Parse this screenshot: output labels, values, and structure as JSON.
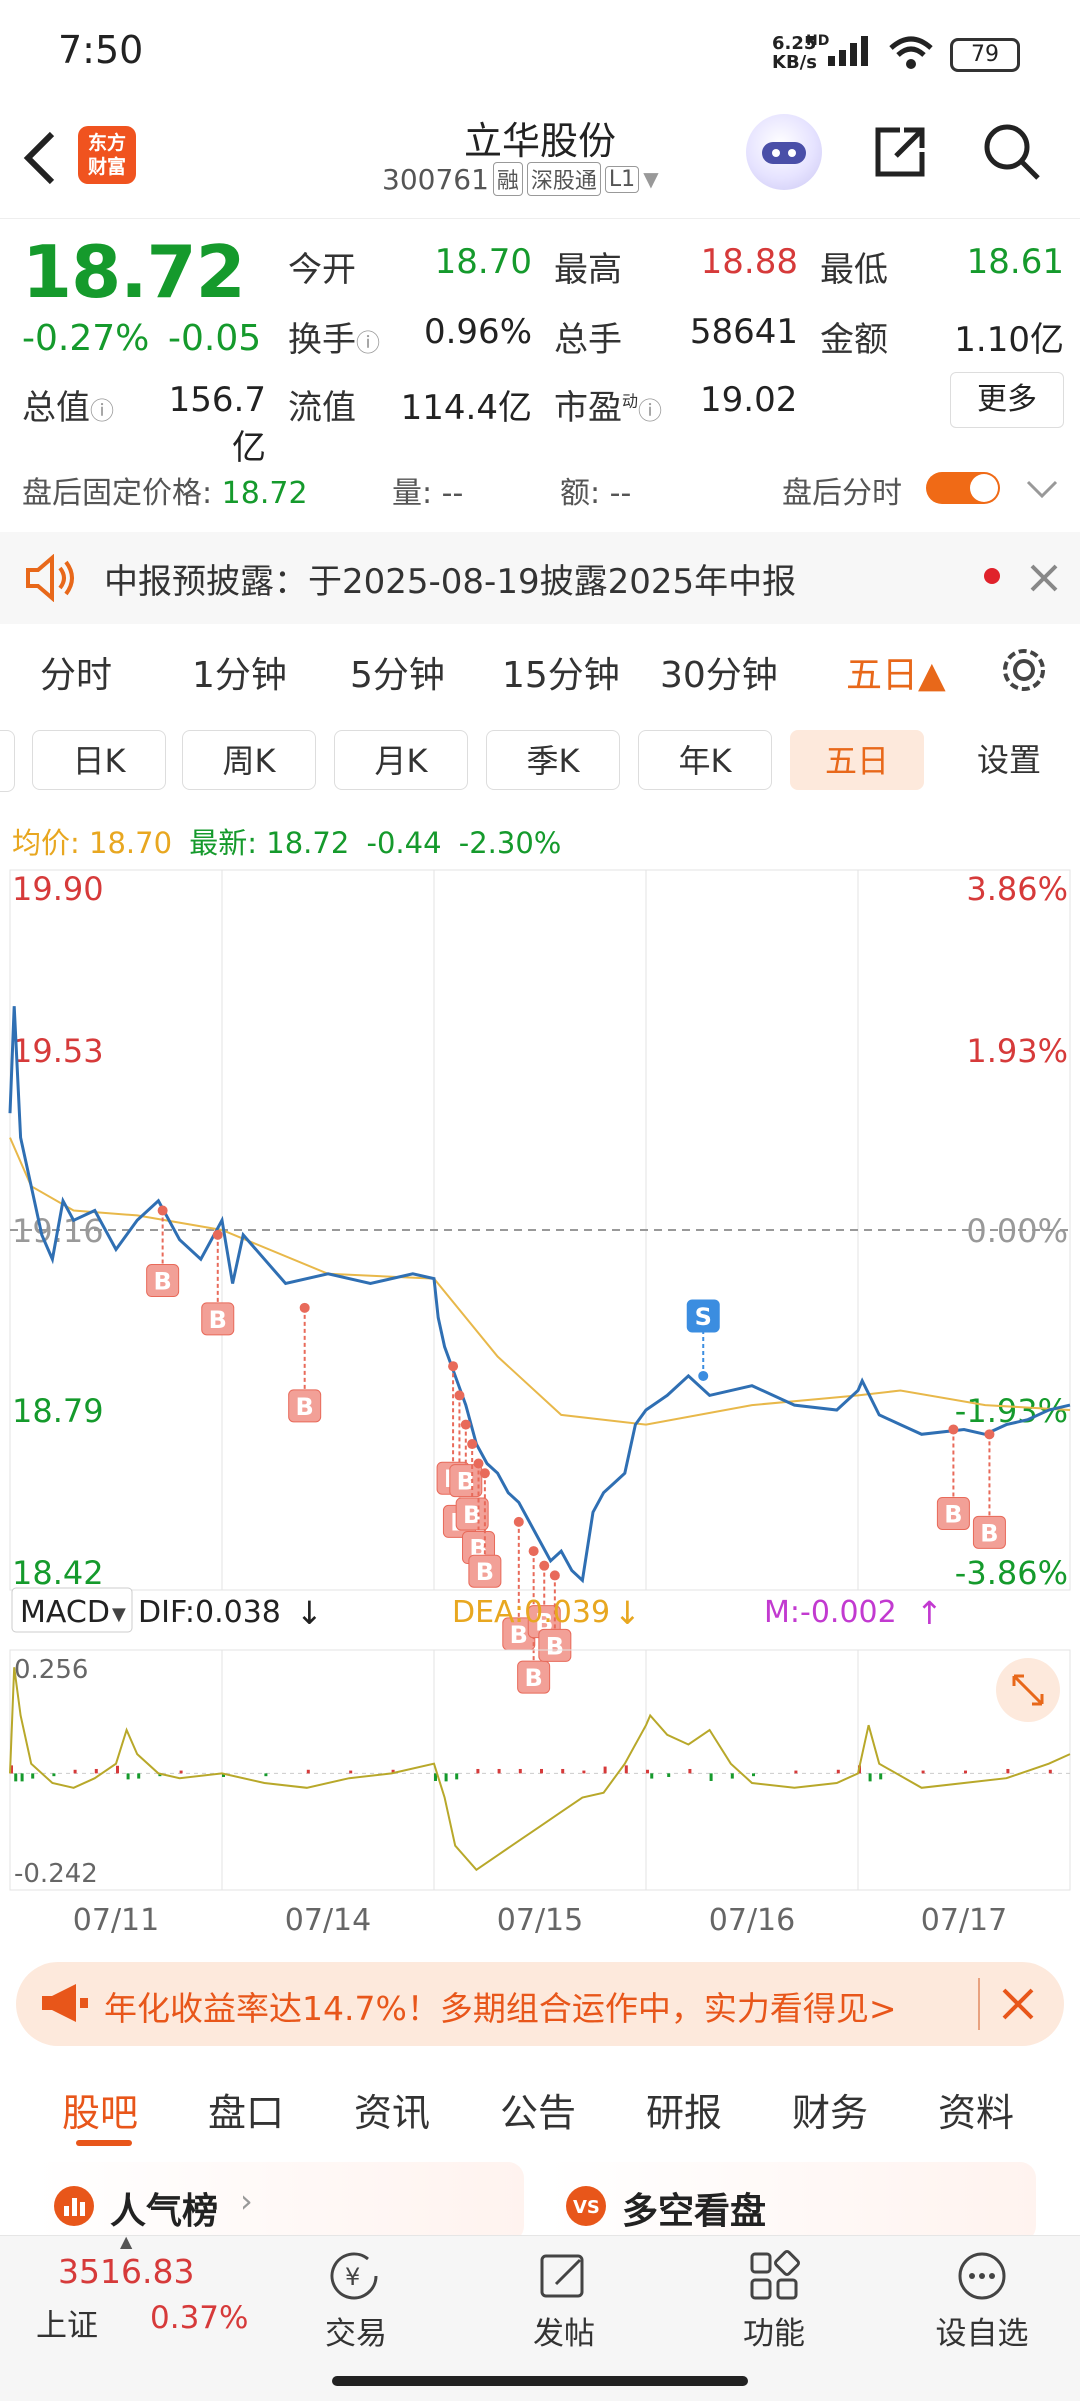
{
  "status_bar": {
    "time": "7:50",
    "net_speed_value": "6.25",
    "net_speed_unit": "KB/s",
    "network": "HD",
    "battery": "79"
  },
  "header": {
    "logo_line1": "东方",
    "logo_line2": "财富",
    "stock_name": "立华股份",
    "stock_code": "300761",
    "tags": [
      "融",
      "深股通",
      "L1"
    ]
  },
  "quote": {
    "price": "18.72",
    "change_pct": "-0.27%",
    "change_abs": "-0.05",
    "open_label": "今开",
    "open": "18.70",
    "high_label": "最高",
    "high": "18.88",
    "low_label": "最低",
    "low": "18.61",
    "turnover_label": "换手",
    "turnover": "0.96%",
    "volume_label": "总手",
    "volume": "58641",
    "amount_label": "金额",
    "amount": "1.10亿",
    "mktcap_label": "总值",
    "mktcap": "156.7亿",
    "float_label": "流值",
    "float": "114.4亿",
    "pe_label": "市盈",
    "pe_sup": "动",
    "pe": "19.02",
    "more_button": "更多"
  },
  "after_hours": {
    "fixed_price_label": "盘后固定价格:",
    "fixed_price": "18.72",
    "vol_label": "量:",
    "vol": "--",
    "amt_label": "额:",
    "amt": "--",
    "toggle_label": "盘后分时",
    "toggle_on": true
  },
  "notice": {
    "text": "中报预披露：于2025-08-19披露2025年中报"
  },
  "period_tabs": [
    "分时",
    "1分钟",
    "5分钟",
    "15分钟",
    "30分钟",
    "五日▲"
  ],
  "k_tabs": [
    "日K",
    "周K",
    "月K",
    "季K",
    "年K",
    "五日",
    "设置"
  ],
  "chart_legend": {
    "avg_label": "均价:",
    "avg": "18.70",
    "latest_label": "最新:",
    "latest": "18.72",
    "chg": "-0.44",
    "chg_pct": "-2.30%"
  },
  "chart_data": [
    {
      "type": "line",
      "y_left_ticks": [
        "19.90",
        "19.53",
        "19.16",
        "18.79",
        "18.42"
      ],
      "y_right_ticks": [
        "3.86%",
        "1.93%",
        "0.00%",
        "-1.93%",
        "-3.86%"
      ],
      "ylim": [
        18.42,
        19.9
      ],
      "x_tick_labels": [
        "07/11",
        "07/14",
        "07/15",
        "07/16",
        "07/17"
      ],
      "series": [
        {
          "x": [
            0,
            0.02,
            0.05,
            0.1,
            0.15,
            0.2,
            0.25,
            0.3,
            0.4,
            0.5,
            0.6,
            0.7,
            0.8,
            0.9,
            1.0,
            1.05,
            1.1,
            1.2,
            1.3,
            1.5,
            1.7,
            1.9,
            2.0,
            2.02,
            2.05,
            2.1,
            2.15,
            2.2,
            2.25,
            2.3,
            2.35,
            2.4,
            2.45,
            2.5,
            2.55,
            2.6,
            2.65,
            2.7,
            2.75,
            2.8,
            2.85,
            2.9,
            2.95,
            3.0,
            3.1,
            3.2,
            3.3,
            3.5,
            3.7,
            3.9,
            4.0,
            4.02,
            4.1,
            4.2,
            4.3,
            4.5,
            4.6,
            4.7,
            4.8,
            4.9,
            5.0
          ],
          "values": [
            19.4,
            19.62,
            19.35,
            19.25,
            19.15,
            19.1,
            19.22,
            19.18,
            19.2,
            19.12,
            19.18,
            19.22,
            19.14,
            19.1,
            19.18,
            19.05,
            19.15,
            19.1,
            19.05,
            19.07,
            19.05,
            19.07,
            19.06,
            18.98,
            18.92,
            18.86,
            18.8,
            18.72,
            18.68,
            18.66,
            18.62,
            18.6,
            18.56,
            18.52,
            18.48,
            18.5,
            18.46,
            18.44,
            18.58,
            18.62,
            18.64,
            18.66,
            18.76,
            18.79,
            18.82,
            18.86,
            18.82,
            18.84,
            18.8,
            18.79,
            18.83,
            18.85,
            18.78,
            18.76,
            18.74,
            18.75,
            18.74,
            18.76,
            18.77,
            18.79,
            18.8
          ]
        },
        {
          "x": [
            0,
            0.1,
            0.3,
            0.6,
            1.0,
            1.5,
            2.0,
            2.3,
            2.6,
            3.0,
            3.5,
            4.0,
            4.2,
            4.6,
            5.0
          ],
          "values": [
            19.35,
            19.25,
            19.2,
            19.19,
            19.16,
            19.07,
            19.06,
            18.9,
            18.78,
            18.76,
            18.8,
            18.82,
            18.83,
            18.8,
            18.79
          ]
        }
      ],
      "markers": [
        {
          "label": "S",
          "x": 3.27,
          "y": 18.86
        },
        {
          "label": "B",
          "x": 0.72,
          "y": 19.2
        },
        {
          "label": "B",
          "x": 0.98,
          "y": 19.15
        },
        {
          "label": "B",
          "x": 1.39,
          "y": 19.0
        },
        {
          "label": "B",
          "x": 2.09,
          "y": 18.88
        },
        {
          "label": "B",
          "x": 2.12,
          "y": 18.82
        },
        {
          "label": "B",
          "x": 2.15,
          "y": 18.76
        },
        {
          "label": "B",
          "x": 2.18,
          "y": 18.72
        },
        {
          "label": "B",
          "x": 2.21,
          "y": 18.68
        },
        {
          "label": "B",
          "x": 2.24,
          "y": 18.66
        },
        {
          "label": "B",
          "x": 2.4,
          "y": 18.56
        },
        {
          "label": "B",
          "x": 2.47,
          "y": 18.5
        },
        {
          "label": "B",
          "x": 2.52,
          "y": 18.47
        },
        {
          "label": "B",
          "x": 2.57,
          "y": 18.45
        },
        {
          "label": "B",
          "x": 4.45,
          "y": 18.75
        },
        {
          "label": "B",
          "x": 4.62,
          "y": 18.74
        }
      ]
    },
    {
      "type": "line",
      "indicator_label": "MACD",
      "dif_label": "DIF:0.038",
      "dea_label": "DEA:0.039",
      "m_label": "M:-0.002",
      "ylim": [
        -0.242,
        0.256
      ],
      "y_ticks": [
        "0.256",
        "-0.242"
      ],
      "series": [
        {
          "x": [
            0,
            0.02,
            0.05,
            0.1,
            0.2,
            0.3,
            0.4,
            0.5,
            0.55,
            0.6,
            0.7,
            0.8,
            1.0,
            1.2,
            1.4,
            1.6,
            1.8,
            2.0,
            2.05,
            2.1,
            2.2,
            2.3,
            2.4,
            2.5,
            2.6,
            2.7,
            2.8,
            2.9,
            3.0,
            3.02,
            3.1,
            3.2,
            3.3,
            3.4,
            3.5,
            3.7,
            3.9,
            4.0,
            4.05,
            4.1,
            4.3,
            4.5,
            4.7,
            4.9,
            5.0
          ],
          "values": [
            0.0,
            0.22,
            0.12,
            0.02,
            -0.02,
            -0.03,
            -0.01,
            0.02,
            0.09,
            0.04,
            0.0,
            -0.01,
            0.0,
            -0.02,
            -0.03,
            -0.01,
            0.0,
            0.02,
            -0.05,
            -0.15,
            -0.2,
            -0.17,
            -0.14,
            -0.11,
            -0.08,
            -0.05,
            -0.04,
            0.02,
            0.1,
            0.12,
            0.08,
            0.06,
            0.09,
            0.02,
            -0.02,
            -0.03,
            -0.02,
            0.0,
            0.1,
            0.02,
            -0.03,
            -0.02,
            -0.01,
            0.02,
            0.04
          ]
        }
      ]
    }
  ],
  "banner": {
    "text": "年化收益率达14.7%！多期组合运作中，实力看得见>"
  },
  "bottom_tabs": [
    "股吧",
    "盘口",
    "资讯",
    "公告",
    "研报",
    "财务",
    "资料"
  ],
  "cards": {
    "left": "人气榜",
    "right": "多空看盘"
  },
  "nav": {
    "index_value": "3516.83",
    "index_name": "上证",
    "index_pct": "0.37%",
    "items": [
      "交易",
      "发帖",
      "功能",
      "设自选"
    ]
  },
  "colors": {
    "up": "#d63a3a",
    "down": "#159a2c",
    "accent": "#e8681a",
    "line": "#2f6fb3",
    "avg": "#e8b84a"
  }
}
